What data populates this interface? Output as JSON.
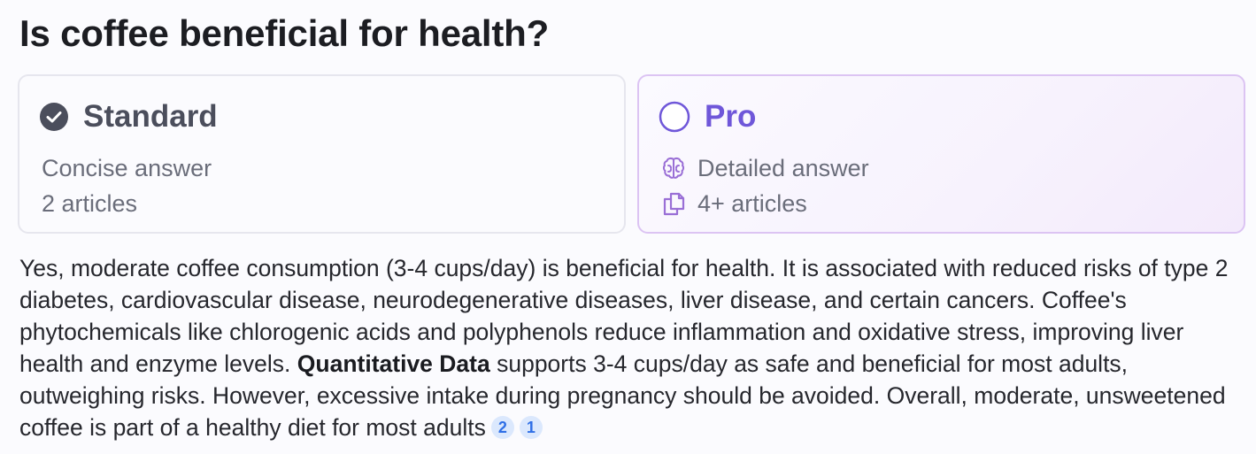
{
  "question": "Is coffee beneficial for health?",
  "modes": {
    "standard": {
      "label": "Standard",
      "features": [
        "Concise answer",
        "2 articles"
      ],
      "selected": true,
      "icon": "check-circle-icon"
    },
    "pro": {
      "label": "Pro",
      "features": [
        {
          "text": "Detailed answer",
          "icon": "brain-icon"
        },
        {
          "text": "4+ articles",
          "icon": "copy-documents-icon"
        }
      ],
      "selected": false,
      "icon": "radio-empty-icon"
    }
  },
  "answer": {
    "part1": "Yes, moderate coffee consumption (3-4 cups/day) is beneficial for health. It is associated with reduced risks of type 2 diabetes, cardiovascular disease, neurodegenerative diseases, liver disease, and certain cancers. Coffee's phytochemicals like chlorogenic acids and polyphenols reduce inflammation and oxidative stress, improving liver health and enzyme levels. ",
    "bold": "Quantitative Data",
    "part2": " supports 3-4 cups/day as safe and beneficial for most adults, outweighing risks. However, excessive intake during pregnancy should be avoided. Overall, moderate, unsweetened coffee is part of a healthy diet for most adults",
    "citations": [
      "2",
      "1"
    ]
  },
  "colors": {
    "pro_accent": "#6f57d9",
    "pro_icon": "#9a6fd6",
    "standard_check": "#4b4e5c",
    "citation_bg": "#dbe8fd",
    "citation_text": "#2f6fe6"
  }
}
